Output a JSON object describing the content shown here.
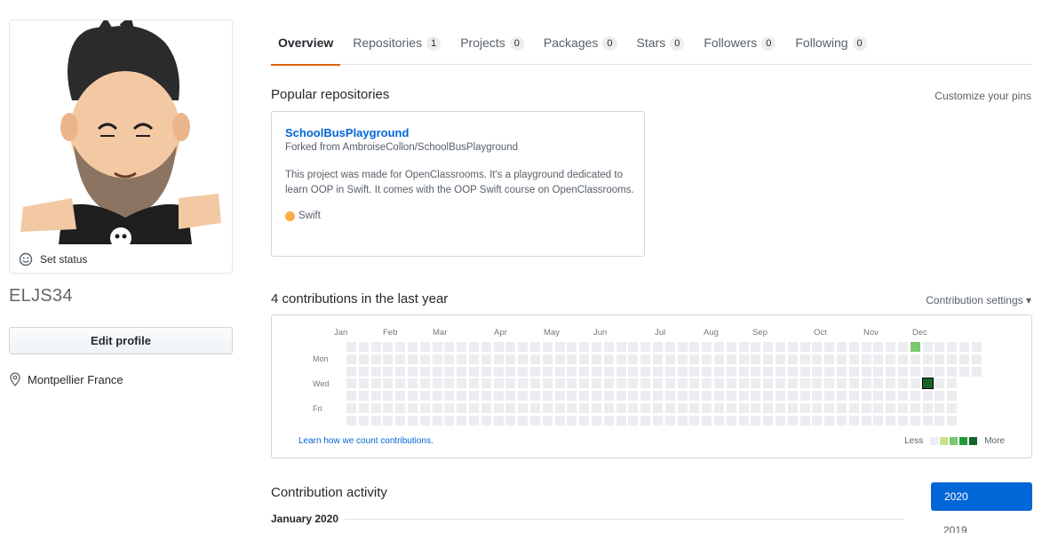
{
  "sidebar": {
    "status_label": "Set status",
    "username": "ELJS34",
    "edit_profile_label": "Edit profile",
    "location": "Montpellier France"
  },
  "tabs": [
    {
      "label": "Overview",
      "count": null,
      "active": true
    },
    {
      "label": "Repositories",
      "count": "1"
    },
    {
      "label": "Projects",
      "count": "0"
    },
    {
      "label": "Packages",
      "count": "0"
    },
    {
      "label": "Stars",
      "count": "0"
    },
    {
      "label": "Followers",
      "count": "0"
    },
    {
      "label": "Following",
      "count": "0"
    }
  ],
  "popular": {
    "title": "Popular repositories",
    "customize_label": "Customize your pins",
    "repo": {
      "name": "SchoolBusPlayground",
      "forked_from": "Forked from AmbroiseCollon/SchoolBusPlayground",
      "description": "This project was made for OpenClassrooms. It's a playground dedicated to learn OOP in Swift. It comes with the OOP Swift course on OpenClassrooms.",
      "language": "Swift",
      "language_color": "#ffac45"
    }
  },
  "contributions": {
    "title": "4 contributions in the last year",
    "settings_label": "Contribution settings ▾",
    "months": [
      "Jan",
      "Feb",
      "Mar",
      "Apr",
      "May",
      "Jun",
      "Jul",
      "Aug",
      "Sep",
      "Oct",
      "Nov",
      "Dec"
    ],
    "day_labels": [
      "Mon",
      "Wed",
      "Fri"
    ],
    "learn_label": "Learn how we count contributions.",
    "legend_less": "Less",
    "legend_more": "More",
    "colors": [
      "#ebedf0",
      "#c6e48b",
      "#7bc96f",
      "#239a3b",
      "#196127"
    ],
    "active_cells": [
      {
        "week": 46,
        "day": 0,
        "level": 2
      },
      {
        "week": 47,
        "day": 3,
        "level": 4
      }
    ]
  },
  "activity": {
    "title": "Contribution activity",
    "month_heading": "January 2020",
    "years": [
      "2020",
      "2019"
    ]
  }
}
